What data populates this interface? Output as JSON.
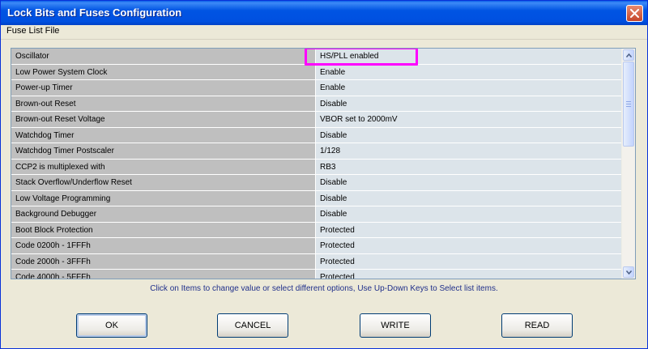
{
  "window": {
    "title": "Lock Bits and Fuses Configuration"
  },
  "menu": {
    "items": [
      {
        "label": "Fuse List File"
      }
    ]
  },
  "fuses": [
    {
      "name": "Oscillator",
      "value": "HS/PLL enabled"
    },
    {
      "name": "Low Power System Clock",
      "value": "Enable"
    },
    {
      "name": "Power-up Timer",
      "value": "Enable"
    },
    {
      "name": "Brown-out Reset",
      "value": "Disable"
    },
    {
      "name": "Brown-out Reset Voltage",
      "value": "VBOR set to 2000mV"
    },
    {
      "name": "Watchdog Timer",
      "value": "Disable"
    },
    {
      "name": "Watchdog Timer Postscaler",
      "value": "1/128"
    },
    {
      "name": "CCP2 is multiplexed with",
      "value": "RB3"
    },
    {
      "name": "Stack Overflow/Underflow Reset",
      "value": "Disable"
    },
    {
      "name": "Low Voltage Programming",
      "value": "Disable"
    },
    {
      "name": "Background Debugger",
      "value": "Disable"
    },
    {
      "name": "Boot Block Protection",
      "value": "Protected"
    },
    {
      "name": "Code 0200h - 1FFFh",
      "value": "Protected"
    },
    {
      "name": "Code 2000h - 3FFFh",
      "value": "Protected"
    },
    {
      "name": "Code 4000h - 5FFFh",
      "value": "Protected"
    }
  ],
  "hint": "Click on Items to change value or select different options, Use Up-Down Keys to Select list items.",
  "buttons": {
    "ok": "OK",
    "cancel": "CANCEL",
    "write": "WRITE",
    "read": "READ"
  },
  "colors": {
    "highlight": "#ff00ff",
    "title_bar": "#0054e3",
    "hint_text": "#1f2f8a"
  },
  "icons": {
    "close": "close-icon",
    "scroll_up": "scroll-up-arrow-icon",
    "scroll_down": "scroll-down-arrow-icon"
  }
}
